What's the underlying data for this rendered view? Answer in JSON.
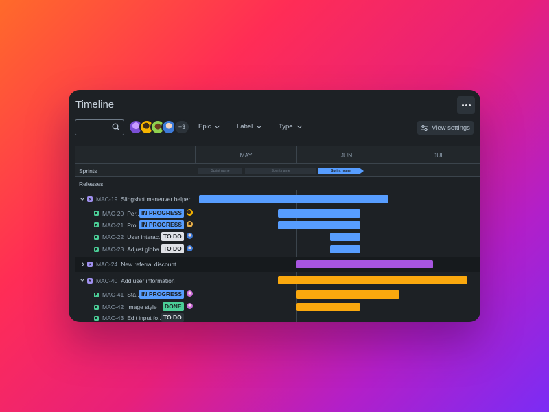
{
  "header": {
    "title": "Timeline"
  },
  "toolbar": {
    "search_placeholder": "",
    "avatars": [
      "avatar-1",
      "avatar-2",
      "avatar-3",
      "avatar-4"
    ],
    "avatars_more": "+3",
    "filters": [
      {
        "label": "Epic"
      },
      {
        "label": "Label"
      },
      {
        "label": "Type"
      }
    ],
    "view_settings_label": "View settings"
  },
  "timeline": {
    "months": [
      "MAY",
      "JUN",
      "JUL"
    ],
    "sprints_label": "Sprints",
    "releases_label": "Releases",
    "sprints": [
      "Sprint name",
      "Sprint name",
      "Sprint name"
    ]
  },
  "colors": {
    "blue": "#579dff",
    "purple": "#a755e0",
    "orange": "#faa80e",
    "epic_icon": "#9f8fef",
    "story_icon": "#4bce97"
  },
  "issues": [
    {
      "key": "MAC-19",
      "summary": "Slingshot maneuver helper...",
      "type": "epic",
      "expanded": true
    },
    {
      "key": "MAC-20",
      "summary": "Per...",
      "type": "story",
      "status": "IN PROGRESS"
    },
    {
      "key": "MAC-21",
      "summary": "Pro...",
      "type": "story",
      "status": "IN PROGRESS"
    },
    {
      "key": "MAC-22",
      "summary": "User interac...",
      "type": "story",
      "status": "TO DO"
    },
    {
      "key": "MAC-23",
      "summary": "Adjust globa...",
      "type": "story",
      "status": "TO DO"
    },
    {
      "key": "MAC-24",
      "summary": "New referral discount",
      "type": "epic",
      "expanded": false
    },
    {
      "key": "MAC-40",
      "summary": "Add user information",
      "type": "epic",
      "expanded": true
    },
    {
      "key": "MAC-41",
      "summary": "Sta...",
      "type": "story",
      "status": "IN PROGRESS"
    },
    {
      "key": "MAC-42",
      "summary": "Image style",
      "type": "story",
      "status": "DONE"
    },
    {
      "key": "MAC-43",
      "summary": "Edit input fo...",
      "type": "story",
      "status": "TO DO"
    }
  ]
}
